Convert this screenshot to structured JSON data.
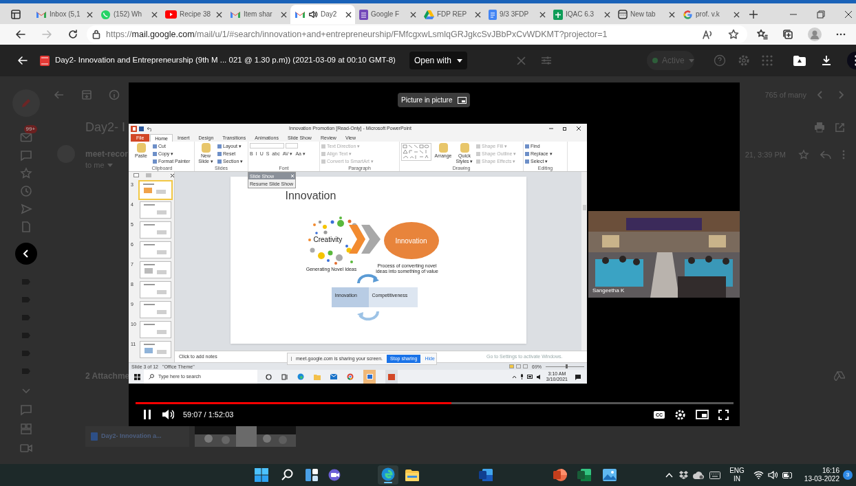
{
  "browser": {
    "tabs": [
      {
        "kind": "gmail",
        "title": "Inbox (5,1",
        "selected": false,
        "audio": false
      },
      {
        "kind": "whatsapp",
        "title": "(152) Wh",
        "selected": false,
        "audio": false
      },
      {
        "kind": "youtube",
        "title": "Recipe 38",
        "selected": false,
        "audio": false
      },
      {
        "kind": "gmail",
        "title": "Item shar",
        "selected": false,
        "audio": false
      },
      {
        "kind": "gmail",
        "title": "Day2",
        "selected": true,
        "audio": true
      },
      {
        "kind": "forms",
        "title": "Google F",
        "selected": false,
        "audio": false
      },
      {
        "kind": "drive",
        "title": "FDP REP",
        "selected": false,
        "audio": false
      },
      {
        "kind": "docs",
        "title": "9/3 3FDP",
        "selected": false,
        "audio": false
      },
      {
        "kind": "sheets",
        "title": "IQAC 6.3",
        "selected": false,
        "audio": false
      },
      {
        "kind": "newtab",
        "title": "New tab",
        "selected": false,
        "audio": false
      },
      {
        "kind": "google",
        "title": "prof. v.k",
        "selected": false,
        "audio": false
      }
    ],
    "url_scheme": "https://",
    "url_host": "mail.google.com",
    "url_path": "/mail/u/1/#search/innovation+and+entrepreneurship/FMfcgxwLsmlqGRJgkcSvJBbPxCvWDKMT?projector=1"
  },
  "viewer": {
    "title": "Day2- Innovation and Entrepreneurship (9th M ... 021 @ 1.30 p.m)) (2021-03-09 at 00:10 GMT-8)",
    "open_with": "Open with",
    "status": "Active",
    "tooltip": "Picture in picture"
  },
  "mail": {
    "badge": "99+",
    "counter": "765 of many",
    "subject": "Day2- I",
    "sender": "meet-recor",
    "recipient": "to me",
    "date": "21, 3:39 PM",
    "attachments": "2 Attachme",
    "attachment_name": "Day2- Innovation a..."
  },
  "shared_screen": {
    "window_title": "Innovation Promotion [Read-Only] - Microsoft PowerPoint",
    "ribbon_tabs": [
      {
        "label": "File",
        "kind": "file",
        "selected": false
      },
      {
        "label": "Home",
        "kind": "tab",
        "selected": true
      },
      {
        "label": "Insert",
        "kind": "tab",
        "selected": false
      },
      {
        "label": "Design",
        "kind": "tab",
        "selected": false
      },
      {
        "label": "Transitions",
        "kind": "tab",
        "selected": false
      },
      {
        "label": "Animations",
        "kind": "tab",
        "selected": false
      },
      {
        "label": "Slide Show",
        "kind": "tab",
        "selected": false
      },
      {
        "label": "Review",
        "kind": "tab",
        "selected": false
      },
      {
        "label": "View",
        "kind": "tab",
        "selected": false
      }
    ],
    "groups": [
      {
        "kind": "commands",
        "label": "Clipboard",
        "large": [
          "Paste"
        ],
        "small": [
          {
            "label": "Cut",
            "disabled": false
          },
          {
            "label": "Copy ▾",
            "disabled": false
          },
          {
            "label": "Format Painter",
            "disabled": false
          }
        ]
      },
      {
        "kind": "commands",
        "label": "Slides",
        "large": [
          "New Slide ▾"
        ],
        "small": [
          {
            "label": "Layout ▾",
            "disabled": false
          },
          {
            "label": "Reset",
            "disabled": false
          },
          {
            "label": "Section ▾",
            "disabled": false
          }
        ]
      },
      {
        "kind": "font",
        "label": "Font",
        "buttons": [
          "B",
          "I",
          "U",
          "S",
          "abc",
          "AV ▾",
          "Aa ▾"
        ]
      },
      {
        "kind": "commands",
        "label": "Paragraph",
        "small": [
          {
            "label": "Text Direction ▾",
            "disabled": true
          },
          {
            "label": "Align Text ▾",
            "disabled": true
          },
          {
            "label": "Convert to SmartArt ▾",
            "disabled": true
          }
        ]
      },
      {
        "kind": "drawing",
        "label": "Drawing",
        "large": [
          "Arrange",
          "Quick Styles ▾"
        ],
        "small": [
          {
            "label": "Shape Fill ▾",
            "disabled": true
          },
          {
            "label": "Shape Outline ▾",
            "disabled": true
          },
          {
            "label": "Shape Effects ▾",
            "disabled": true
          }
        ]
      },
      {
        "kind": "commands",
        "label": "Editing",
        "small": [
          {
            "label": "Find",
            "disabled": false
          },
          {
            "label": "Replace ▾",
            "disabled": false
          },
          {
            "label": "Select ▾",
            "disabled": false
          }
        ]
      }
    ],
    "thumbnails": [
      {
        "number": "3",
        "selected": true
      },
      {
        "number": "4",
        "selected": false
      },
      {
        "number": "5",
        "selected": false
      },
      {
        "number": "6",
        "selected": false
      },
      {
        "number": "7",
        "selected": false
      },
      {
        "number": "8",
        "selected": false
      },
      {
        "number": "9",
        "selected": false
      },
      {
        "number": "10",
        "selected": false
      },
      {
        "number": "11",
        "selected": false
      }
    ],
    "popup": {
      "title": "Slide Show",
      "action": "Resume Slide Show"
    },
    "slide": {
      "title": "Innovation",
      "left_label": "Creativity",
      "right_label": "Innovation",
      "left_caption": "Generating Novel Ideas",
      "right_caption": "Process of converting novel ideas into something of value",
      "cycle": [
        "Innovation",
        "Competitiveness"
      ]
    },
    "notes": "Click to add notes",
    "share_bar": {
      "message": "meet.google.com is sharing your screen.",
      "stop": "Stop sharing",
      "hide": "Hide"
    },
    "activation": "Go to Settings to activate Windows.",
    "status": {
      "slide": "Slide 3 of 12",
      "theme": "\"Office Theme\"",
      "zoom": "69%",
      "level": 0.55
    },
    "taskbar": {
      "search": "Type here to search",
      "time": "3:10 AM",
      "date": "3/10/2021"
    }
  },
  "camera": {
    "name": "Sangeetha K"
  },
  "player": {
    "playing": true,
    "level": 0.528,
    "time": "59:07 / 1:52:03",
    "captions": "CC"
  },
  "taskbar": {
    "language": "ENG",
    "region": "IN",
    "time": "16:16",
    "date": "13-03-2022",
    "notifications": "3"
  }
}
